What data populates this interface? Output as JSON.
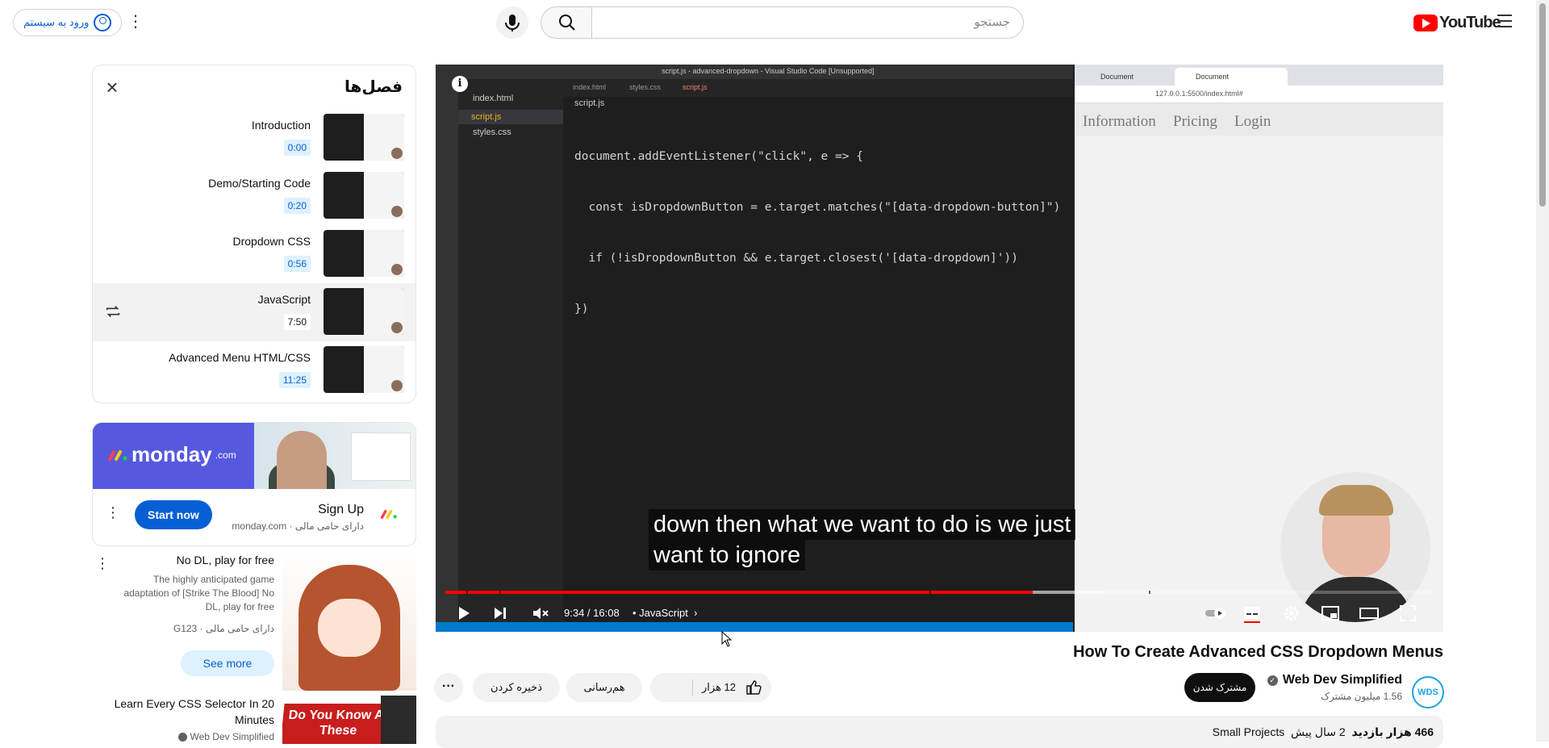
{
  "header": {
    "signin_label": "ورود به سیستم",
    "search_placeholder": "جستجو",
    "logo_text": "YouTube"
  },
  "chapters": {
    "title": "فصل‌ها",
    "items": [
      {
        "title": "Introduction",
        "time": "0:00"
      },
      {
        "title": "Demo/Starting Code",
        "time": "0:20"
      },
      {
        "title": "Dropdown CSS",
        "time": "0:56"
      },
      {
        "title": "JavaScript",
        "time": "7:50",
        "active": true
      },
      {
        "title": "Advanced Menu HTML/CSS",
        "time": "11:25"
      }
    ]
  },
  "ad": {
    "brand_logo": "monday",
    "brand_logo_suffix": ".com",
    "title": "Sign Up",
    "subtitle": "دارای حامی مالی · monday.com",
    "cta": "Start now"
  },
  "sponsored_game": {
    "title": "No DL, play for free",
    "description": "The highly anticipated game adaptation of [Strike The Blood] No DL, play for free",
    "subtitle": "دارای حامی مالی · G123",
    "cta": "See more"
  },
  "next_video": {
    "title": "Learn Every CSS Selector In 20 Minutes",
    "channel": "Web Dev Simplified",
    "thumb_text": "Do You Know All These"
  },
  "player": {
    "editor_title": "script.js - advanced-dropdown - Visual Studio Code [Unsupported]",
    "files": [
      "index.html",
      "script.js",
      "styles.css"
    ],
    "tabs": [
      "index.html",
      "styles.css",
      "script.js"
    ],
    "open_file": "script.js",
    "code_lines": [
      "document.addEventListener(\"click\", e => {",
      "  const isDropdownButton = e.target.matches(\"[data-dropdown-button]\")",
      "  if (!isDropdownButton && e.target.closest('[data-dropdown]'))",
      "})"
    ],
    "browser_tabs": [
      "Document",
      "Document"
    ],
    "browser_url": "127.0.0.1:5500/index.html#",
    "page_nav": [
      "Information",
      "Pricing",
      "Login"
    ],
    "caption_lines": [
      "down then what we want to do is we just",
      "want to ignore"
    ],
    "time": "9:34 / 16:08",
    "chapter_label": "• JavaScript",
    "progress": {
      "played_fraction": 0.594,
      "loaded_fraction": 0.668,
      "chapter_marks": [
        0.021,
        0.055,
        0.49,
        0.712
      ]
    }
  },
  "video": {
    "title": "How To Create Advanced CSS Dropdown Menus",
    "channel_name": "Web Dev Simplified",
    "channel_avatar": "WDS",
    "subscribers": "1.56 میلیون مشترک",
    "subscribe_label": "مشترک شدن",
    "like_count": "12 هزار",
    "share_label": "هم‌رسانی",
    "save_label": "ذخیره کردن",
    "views": "466 هزار بازدید",
    "age": "2 سال پیش",
    "tag": "Small Projects"
  }
}
